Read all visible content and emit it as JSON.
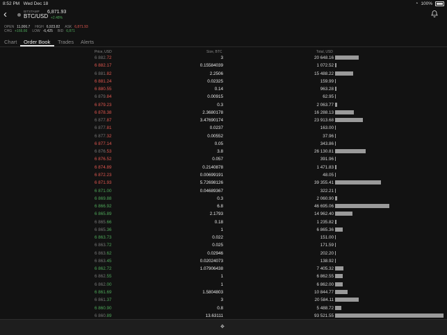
{
  "status_bar": {
    "time": "8:52 PM",
    "date": "Wed Dec 18",
    "battery": "100%"
  },
  "header": {
    "exchange": "BITSTAMP",
    "pair": "BTC/USD",
    "price": "6,871.93",
    "change": "+2.48%",
    "back_icon": "chevron-left-icon",
    "bell_icon": "bell-icon"
  },
  "stats": {
    "row1": [
      {
        "label": "OPEN",
        "value": "11,006.7",
        "tone": "neutral"
      },
      {
        "label": "HIGH",
        "value": "6,923.82",
        "tone": "neutral"
      },
      {
        "label": "ASK",
        "value": "6,871.93",
        "tone": "neg"
      }
    ],
    "row2": [
      {
        "label": "CHG",
        "value": "+166.66",
        "tone": "pos"
      },
      {
        "label": "LOW",
        "value": "-6,425",
        "tone": "neutral"
      },
      {
        "label": "BID",
        "value": "6,871",
        "tone": "pos"
      }
    ]
  },
  "tabs": [
    "Chart",
    "Order Book",
    "Trades",
    "Alerts"
  ],
  "active_tab": "Order Book",
  "columns": {
    "price": "Price, USD",
    "size": "Size, BTC",
    "total": "Total, USD"
  },
  "colors": {
    "ask": "#e0574f",
    "bid": "#4fa85a",
    "bar": "#9a9a9a"
  },
  "max_total": 93521.55,
  "order_book": [
    {
      "side": "ask",
      "price_dim": "6 882.",
      "price_bright": "72",
      "size": "3",
      "total": "20 648.16",
      "total_value": 20648.16
    },
    {
      "side": "ask",
      "price_dim": "",
      "price_bright": "6 882.17",
      "size": "0.15584039",
      "total": "1 072.52",
      "total_value": 1072.52
    },
    {
      "side": "ask",
      "price_dim": "6 881.",
      "price_bright": "82",
      "size": "2.2506",
      "total": "15 488.22",
      "total_value": 15488.22
    },
    {
      "side": "ask",
      "price_dim": "",
      "price_bright": "6 881.24",
      "size": "0.02325",
      "total": "159.99",
      "total_value": 159.99
    },
    {
      "side": "ask",
      "price_dim": "",
      "price_bright": "6 880.55",
      "size": "0.14",
      "total": "963.28",
      "total_value": 963.28
    },
    {
      "side": "ask",
      "price_dim": "6 879.",
      "price_bright": "84",
      "size": "0.00915",
      "total": "62.95",
      "total_value": 62.95
    },
    {
      "side": "ask",
      "price_dim": "",
      "price_bright": "6 879.23",
      "size": "0.3",
      "total": "2 063.77",
      "total_value": 2063.77
    },
    {
      "side": "ask",
      "price_dim": "",
      "price_bright": "6 878.38",
      "size": "2.3680178",
      "total": "16 288.13",
      "total_value": 16288.13
    },
    {
      "side": "ask",
      "price_dim": "6 877.",
      "price_bright": "87",
      "size": "3.47690174",
      "total": "23 913.68",
      "total_value": 23913.68
    },
    {
      "side": "ask",
      "price_dim": "6 877.",
      "price_bright": "81",
      "size": "0.0237",
      "total": "163.00",
      "total_value": 163.0
    },
    {
      "side": "ask",
      "price_dim": "6 877.",
      "price_bright": "32",
      "size": "0.00552",
      "total": "37.96",
      "total_value": 37.96
    },
    {
      "side": "ask",
      "price_dim": "",
      "price_bright": "6 877.14",
      "size": "0.05",
      "total": "343.86",
      "total_value": 343.86
    },
    {
      "side": "ask",
      "price_dim": "6 876.",
      "price_bright": "53",
      "size": "3.8",
      "total": "26 130.81",
      "total_value": 26130.81
    },
    {
      "side": "ask",
      "price_dim": "",
      "price_bright": "6 876.52",
      "size": "0.057",
      "total": "391.96",
      "total_value": 391.96
    },
    {
      "side": "ask",
      "price_dim": "",
      "price_bright": "6 874.89",
      "size": "0.2140878",
      "total": "1 471.83",
      "total_value": 1471.83
    },
    {
      "side": "ask",
      "price_dim": "",
      "price_bright": "6 872.23",
      "size": "0.00699191",
      "total": "48.05",
      "total_value": 48.05
    },
    {
      "side": "ask",
      "price_dim": "",
      "price_bright": "6 871.93",
      "size": "5.72698126",
      "total": "39 355.41",
      "total_value": 39355.41
    },
    {
      "side": "bid",
      "price_dim": "",
      "price_bright": "6 871.00",
      "size": "0.04689367",
      "total": "322.21",
      "total_value": 322.21
    },
    {
      "side": "bid",
      "price_dim": "",
      "price_bright": "6 869.88",
      "size": "0.3",
      "total": "2 060.90",
      "total_value": 2060.9
    },
    {
      "side": "bid",
      "price_dim": "",
      "price_bright": "6 866.92",
      "size": "6.8",
      "total": "46 695.06",
      "total_value": 46695.06
    },
    {
      "side": "bid",
      "price_dim": "",
      "price_bright": "6 865.89",
      "size": "2.1793",
      "total": "14 962.40",
      "total_value": 14962.4
    },
    {
      "side": "bid",
      "price_dim": "6 865.",
      "price_bright": "66",
      "size": "0.18",
      "total": "1 235.82",
      "total_value": 1235.82
    },
    {
      "side": "bid",
      "price_dim": "6 865.",
      "price_bright": "36",
      "size": "1",
      "total": "6 865.36",
      "total_value": 6865.36
    },
    {
      "side": "bid",
      "price_dim": "",
      "price_bright": "6 863.73",
      "size": "0.022",
      "total": "151.00",
      "total_value": 151.0
    },
    {
      "side": "bid",
      "price_dim": "6 863.",
      "price_bright": "72",
      "size": "0.025",
      "total": "171.59",
      "total_value": 171.59
    },
    {
      "side": "bid",
      "price_dim": "6 863.",
      "price_bright": "62",
      "size": "0.02946",
      "total": "202.20",
      "total_value": 202.2
    },
    {
      "side": "bid",
      "price_dim": "6 863.",
      "price_bright": "45",
      "size": "0.02024073",
      "total": "138.92",
      "total_value": 138.92
    },
    {
      "side": "bid",
      "price_dim": "",
      "price_bright": "6 862.72",
      "size": "1.07906438",
      "total": "7 405.32",
      "total_value": 7405.32
    },
    {
      "side": "bid",
      "price_dim": "6 862.",
      "price_bright": "55",
      "size": "1",
      "total": "6 862.55",
      "total_value": 6862.55
    },
    {
      "side": "bid",
      "price_dim": "6 862.",
      "price_bright": "00",
      "size": "1",
      "total": "6 862.00",
      "total_value": 6862.0
    },
    {
      "side": "bid",
      "price_dim": "",
      "price_bright": "6 861.69",
      "size": "1.5804803",
      "total": "10 844.77",
      "total_value": 10844.77
    },
    {
      "side": "bid",
      "price_dim": "6 861.",
      "price_bright": "37",
      "size": "3",
      "total": "20 584.11",
      "total_value": 20584.11
    },
    {
      "side": "bid",
      "price_dim": "",
      "price_bright": "6 860.90",
      "size": "0.8",
      "total": "5 488.72",
      "total_value": 5488.72
    },
    {
      "side": "bid",
      "price_dim": "6 860.",
      "price_bright": "89",
      "size": "13.63111",
      "total": "93 521.55",
      "total_value": 93521.55
    }
  ],
  "footer": {
    "handle_icon": "drag-handle-icon"
  }
}
